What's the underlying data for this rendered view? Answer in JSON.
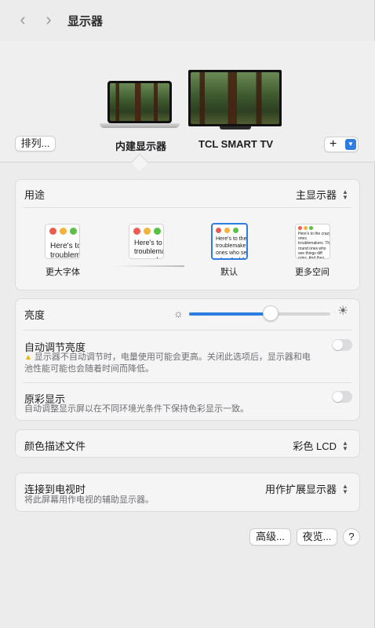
{
  "window": {
    "title": "显示器"
  },
  "nav": {
    "back_icon": "chevron-left-icon",
    "forward_icon": "chevron-right-icon"
  },
  "arrange": {
    "arrange_label": "排列...",
    "displays": [
      {
        "name": "内建显示器",
        "selected": true
      },
      {
        "name": "TCL SMART TV",
        "selected": false
      }
    ],
    "add_label": "+",
    "add_menu_icon": "chevron-down-icon"
  },
  "usage": {
    "label": "用途",
    "value": "主显示器",
    "resolutions": [
      {
        "label": "更大字体",
        "preview": "Here's to troublemak",
        "selected": false
      },
      {
        "label": "",
        "preview": "Here's to t troublemak ones who s",
        "selected": false
      },
      {
        "label": "默认",
        "preview": "Here's to the c troublemakers. ones who see t rules. And they",
        "selected": true
      },
      {
        "label": "更多空间",
        "preview": "Here's to the crazy ones troublemakers. The round ones who see things diff rules. And they have no can quote them, disagr them. About the only th Because they change th",
        "selected": false
      }
    ]
  },
  "brightness": {
    "label": "亮度",
    "level": 0.58,
    "auto_label": "自动调节亮度",
    "auto_note": "显示器不自动调节时，电量使用可能会更高。关闭此选项后，显示器和电池性能可能也会随着时间而降低。",
    "auto_enabled": false,
    "truetone_label": "原彩显示",
    "truetone_note": "自动调整显示屏以在不同环境光条件下保持色彩显示一致。",
    "truetone_enabled": false
  },
  "color_profile": {
    "label": "颜色描述文件",
    "value": "彩色 LCD"
  },
  "tv": {
    "label": "连接到电视时",
    "note": "将此屏幕用作电视的辅助显示器。",
    "value": "用作扩展显示器"
  },
  "footer": {
    "advanced_label": "高级...",
    "nightshift_label": "夜览...",
    "help_label": "?"
  },
  "colors": {
    "accent": "#2f7de1",
    "warning": "#f0b400"
  }
}
